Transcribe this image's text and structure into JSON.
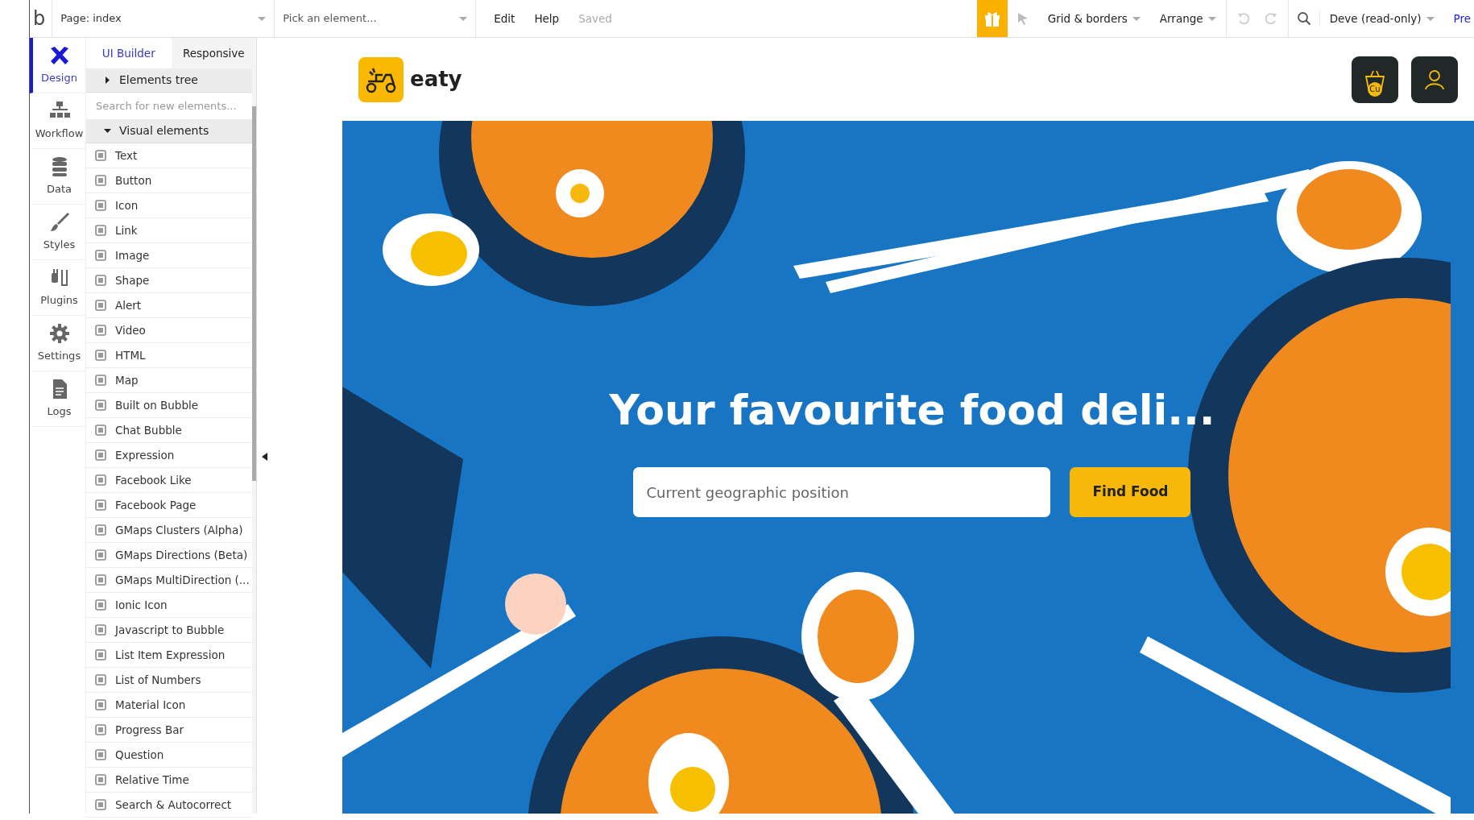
{
  "app_bar": {
    "logo": "b",
    "page_selector": "Page: index",
    "element_picker": "Pick an element...",
    "menu": [
      {
        "label": "Edit"
      },
      {
        "label": "Help"
      }
    ],
    "save_status": "Saved",
    "dropdowns": [
      {
        "label": "Grid & borders"
      },
      {
        "label": "Arrange"
      }
    ],
    "version_selector": "Deve (read-only)",
    "preview_link": "Pre"
  },
  "rail": {
    "items": [
      {
        "label": "Design",
        "selected": true
      },
      {
        "label": "Workflow",
        "selected": false
      },
      {
        "label": "Data",
        "selected": false
      },
      {
        "label": "Styles",
        "selected": false
      },
      {
        "label": "Plugins",
        "selected": false
      },
      {
        "label": "Settings",
        "selected": false
      },
      {
        "label": "Logs",
        "selected": false
      }
    ]
  },
  "panel": {
    "tabs": [
      {
        "label": "UI Builder",
        "selected": true
      },
      {
        "label": "Responsive",
        "selected": false
      }
    ],
    "elements_tree": {
      "label": "Elements tree",
      "expanded": false
    },
    "search": {
      "placeholder": "Search for new elements..."
    },
    "visual_elements": {
      "label": "Visual elements",
      "expanded": true,
      "items": [
        {
          "label": "Text"
        },
        {
          "label": "Button"
        },
        {
          "label": "Icon"
        },
        {
          "label": "Link"
        },
        {
          "label": "Image"
        },
        {
          "label": "Shape"
        },
        {
          "label": "Alert"
        },
        {
          "label": "Video"
        },
        {
          "label": "HTML"
        },
        {
          "label": "Map"
        },
        {
          "label": "Built on Bubble"
        },
        {
          "label": "Chat Bubble"
        },
        {
          "label": "Expression"
        },
        {
          "label": "Facebook Like"
        },
        {
          "label": "Facebook Page"
        },
        {
          "label": "GMaps Clusters (Alpha)"
        },
        {
          "label": "GMaps Directions (Beta)"
        },
        {
          "label": "GMaps MultiDirection (..."
        },
        {
          "label": "Ionic Icon"
        },
        {
          "label": "Javascript to Bubble"
        },
        {
          "label": "List Item Expression"
        },
        {
          "label": "List of Numbers"
        },
        {
          "label": "Material Icon"
        },
        {
          "label": "Progress Bar"
        },
        {
          "label": "Question"
        },
        {
          "label": "Relative Time"
        },
        {
          "label": "Search & Autocorrect"
        }
      ]
    }
  },
  "canvas": {
    "brand": "eaty",
    "cart_badge": "Cu",
    "hero": {
      "heading": "Your favourite food deli...",
      "location_field": {
        "placeholder": "Current geographic position"
      },
      "button": "Find Food"
    }
  }
}
